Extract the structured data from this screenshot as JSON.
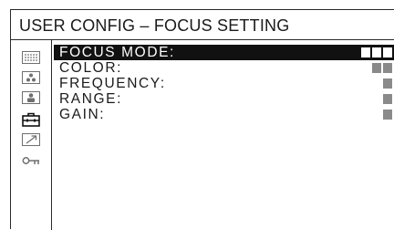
{
  "header": {
    "title": "USER CONFIG – FOCUS SETTING"
  },
  "sidebar": {
    "icons": [
      {
        "name": "grid-dots-icon"
      },
      {
        "name": "color-dots-icon"
      },
      {
        "name": "person-icon"
      },
      {
        "name": "toolbox-icon",
        "selected": true
      },
      {
        "name": "arrow-icon"
      },
      {
        "name": "key-icon"
      }
    ]
  },
  "menu": {
    "items": [
      {
        "label": "FOCUS MODE:",
        "level": 3,
        "selected": true
      },
      {
        "label": "COLOR:",
        "level": 2
      },
      {
        "label": "FREQUENCY:",
        "level": 1
      },
      {
        "label": "RANGE:",
        "level": 1
      },
      {
        "label": "GAIN:",
        "level": 1
      }
    ]
  },
  "colors": {
    "highlight": "#111111",
    "bar": "#8a8a8a"
  }
}
